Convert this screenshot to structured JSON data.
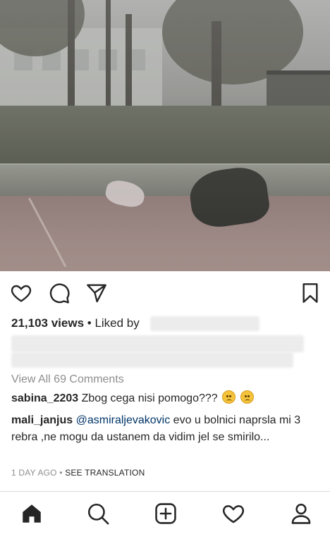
{
  "post": {
    "views_count": "21,103 views",
    "separator": " • ",
    "liked_by_label": "Liked by"
  },
  "comments": {
    "view_all_label": "View All 69 Comments",
    "items": [
      {
        "username": "sabina_2203",
        "text": " Zbog cega nisi pomogo??? ",
        "emoji": [
          "slightly-frowning-face-emoji",
          "frowning-face-emoji"
        ]
      },
      {
        "username": "mali_janjus",
        "mention": "@asmiraljevakovic",
        "text": " evo u bolnici naprsla mi 3 rebra ,ne mogu da ustanem da vidim jel se smirilo..."
      }
    ]
  },
  "meta": {
    "time_ago": "1 DAY AGO",
    "separator": " • ",
    "see_translation": "SEE TRANSLATION"
  },
  "icons": {
    "like": "heart-icon",
    "comment": "comment-bubble-icon",
    "share": "paper-plane-icon",
    "save": "bookmark-icon",
    "nav_home": "home-icon",
    "nav_search": "search-icon",
    "nav_add": "add-post-icon",
    "nav_activity": "heart-activity-icon",
    "nav_profile": "profile-icon"
  },
  "colors": {
    "text": "#262626",
    "muted": "#8e8e8e",
    "mention": "#003569",
    "divider": "#dbdbdb"
  }
}
